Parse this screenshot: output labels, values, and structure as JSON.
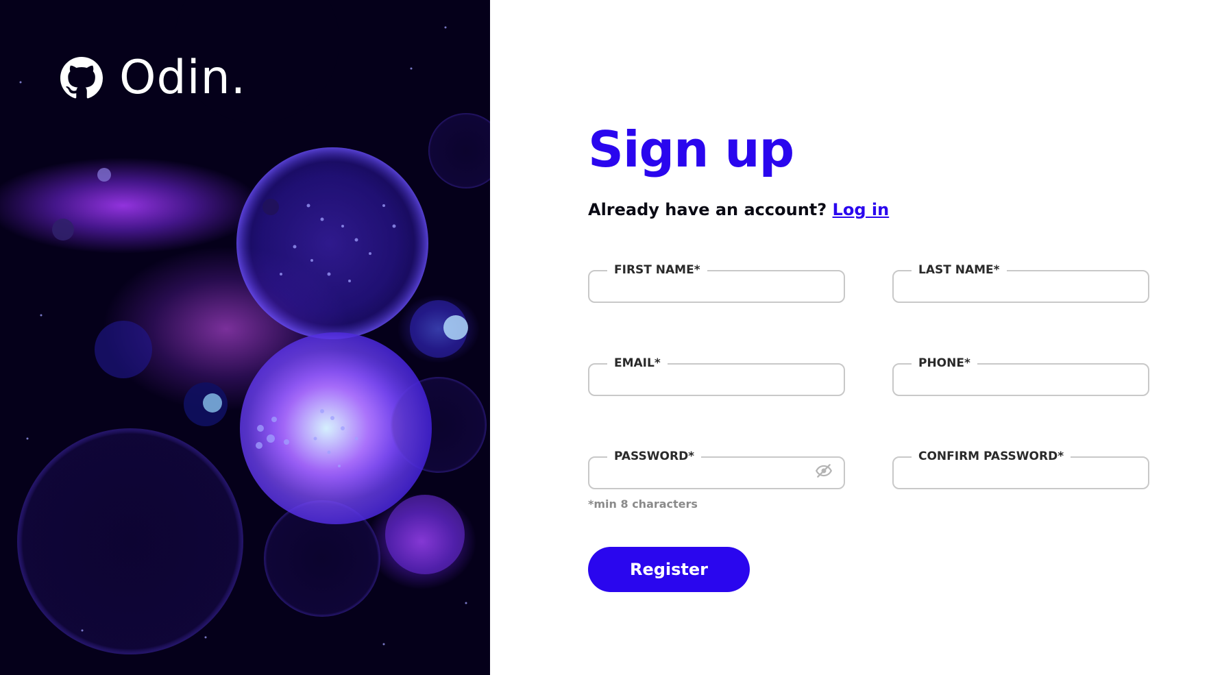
{
  "brand": {
    "name": "Odin.",
    "icon": "github-icon"
  },
  "colors": {
    "accent": "#2a06ee",
    "border": "#c8c8c8",
    "hint": "#8a8a8a",
    "hero_bg": "#05001a"
  },
  "form": {
    "title": "Sign up",
    "login_prompt": "Already have an account?",
    "login_link": "Log in",
    "fields": {
      "first_name": {
        "label": "FIRST NAME*",
        "value": ""
      },
      "last_name": {
        "label": "LAST NAME*",
        "value": ""
      },
      "email": {
        "label": "EMAIL*",
        "value": ""
      },
      "phone": {
        "label": "PHONE*",
        "value": ""
      },
      "password": {
        "label": "PASSWORD*",
        "value": "",
        "toggle_icon": "eye-off-icon"
      },
      "confirm_password": {
        "label": "CONFIRM PASSWORD*",
        "value": ""
      }
    },
    "password_hint": "*min 8 characters",
    "submit_label": "Register"
  }
}
